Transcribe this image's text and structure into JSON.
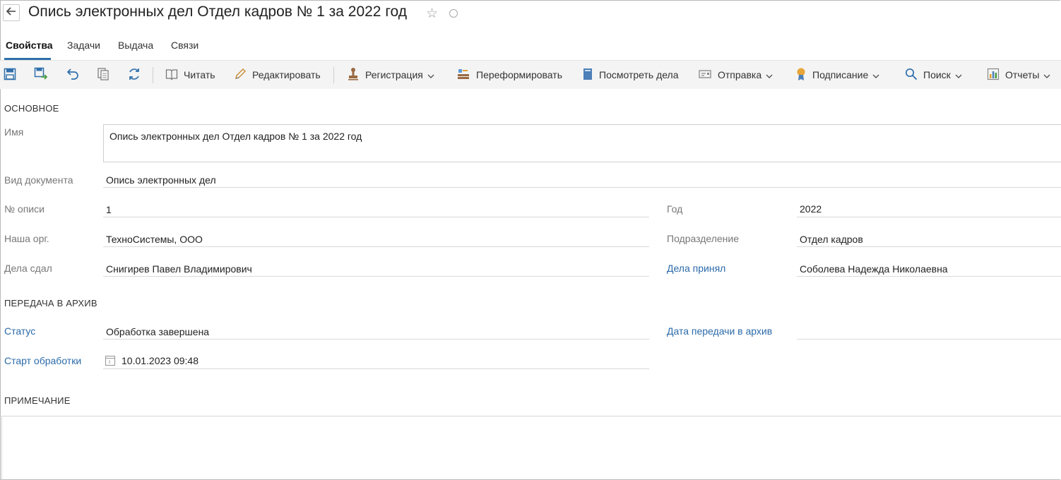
{
  "header": {
    "title": "Опись электронных дел Отдел кадров № 1 за 2022 год"
  },
  "tabs": [
    {
      "label": "Свойства",
      "active": true
    },
    {
      "label": "Задачи",
      "active": false
    },
    {
      "label": "Выдача",
      "active": false
    },
    {
      "label": "Связи",
      "active": false
    }
  ],
  "toolbar": {
    "read": "Читать",
    "edit": "Редактировать",
    "registration": "Регистрация",
    "reform": "Переформировать",
    "view_cases": "Посмотреть дела",
    "send": "Отправка",
    "signing": "Подписание",
    "search": "Поиск",
    "reports": "Отчеты"
  },
  "sections": {
    "main": "ОСНОВНОЕ",
    "archive": "ПЕРЕДАЧА В АРХИВ",
    "note": "ПРИМЕЧАНИЕ"
  },
  "fields": {
    "name": {
      "label": "Имя",
      "value": "Опись электронных дел Отдел кадров № 1 за 2022 год"
    },
    "doc_type": {
      "label": "Вид документа",
      "value": "Опись электронных дел"
    },
    "inventory_no": {
      "label": "№ описи",
      "value": "1"
    },
    "year": {
      "label": "Год",
      "value": "2022"
    },
    "our_org": {
      "label": "Наша орг.",
      "value": "ТехноСистемы, ООО"
    },
    "department": {
      "label": "Подразделение",
      "value": "Отдел кадров"
    },
    "handed_by": {
      "label": "Дела сдал",
      "value": "Снигирев Павел Владимирович"
    },
    "accepted_by": {
      "label": "Дела принял",
      "value": "Соболева Надежда Николаевна"
    },
    "status": {
      "label": "Статус",
      "value": "Обработка завершена"
    },
    "transfer_date": {
      "label": "Дата передачи в архив",
      "value": ""
    },
    "processing_start": {
      "label": "Старт обработки",
      "value": "10.01.2023 09:48"
    },
    "note": {
      "value": ""
    }
  },
  "colors": {
    "accent": "#2f6fab",
    "link": "#2b6aa9",
    "toolbar_bg": "#f4f4f4"
  }
}
